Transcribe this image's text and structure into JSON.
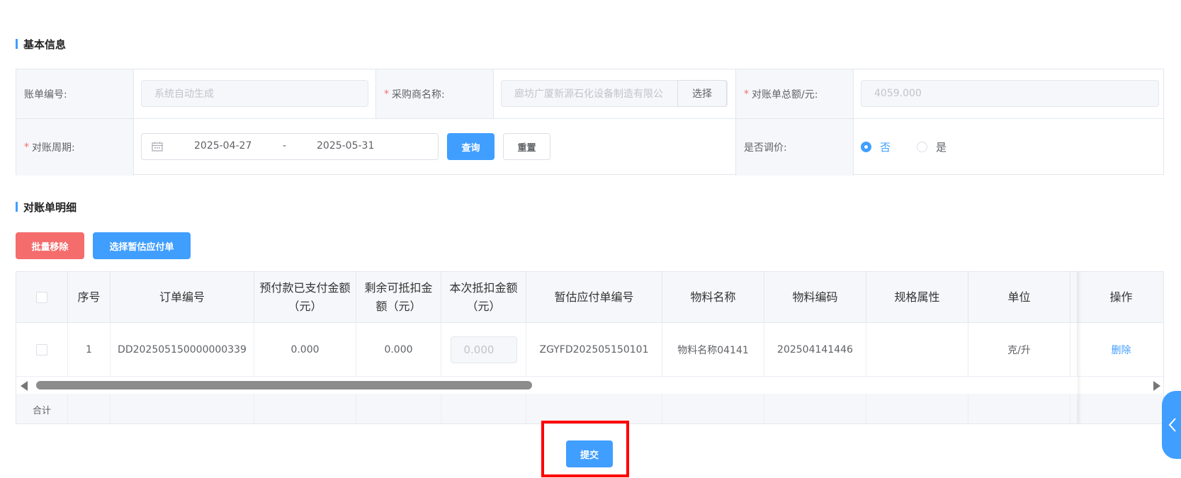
{
  "sections": {
    "basic_info": "基本信息",
    "detail": "对账单明细"
  },
  "form": {
    "bill_no_label": "账单编号:",
    "bill_no_placeholder": "系统自动生成",
    "buyer_label": "采购商名称:",
    "buyer_value": "廊坊广厦新源石化设备制造有限公",
    "buyer_select": "选择",
    "total_label": "对账单总额/元:",
    "total_value": "4059.000",
    "period_label": "对账周期:",
    "period_start": "2025-04-27",
    "period_sep": "-",
    "period_end": "2025-05-31",
    "query_button": "查询",
    "reset_button": "重置",
    "adjust_label": "是否调价:",
    "adjust_no": "否",
    "adjust_yes": "是",
    "adjust_selected": "否"
  },
  "toolbar": {
    "batch_remove": "批量移除",
    "select_estimate": "选择暂估应付单"
  },
  "table": {
    "headers": {
      "index": "序号",
      "order_no": "订单编号",
      "prepaid": "预付款已支付金额（元）",
      "remaining": "剩余可抵扣金额（元）",
      "current": "本次抵扣金额（元）",
      "estimate_no": "暂估应付单编号",
      "material_name": "物料名称",
      "material_code": "物料编码",
      "spec": "规格属性",
      "unit": "单位",
      "action": "操作"
    },
    "rows": [
      {
        "index": "1",
        "order_no": "DD202505150000000339",
        "prepaid": "0.000",
        "remaining": "0.000",
        "current": "0.000",
        "estimate_no": "ZGYFD202505150101",
        "material_name": "物料名称04141",
        "material_code": "202504141446",
        "spec": "",
        "unit": "克/升",
        "action": "删除"
      }
    ],
    "footer_label": "合计"
  },
  "submit_button": "提交",
  "colors": {
    "primary": "#409eff",
    "danger": "#f56c6c",
    "highlight": "#ff0000"
  }
}
